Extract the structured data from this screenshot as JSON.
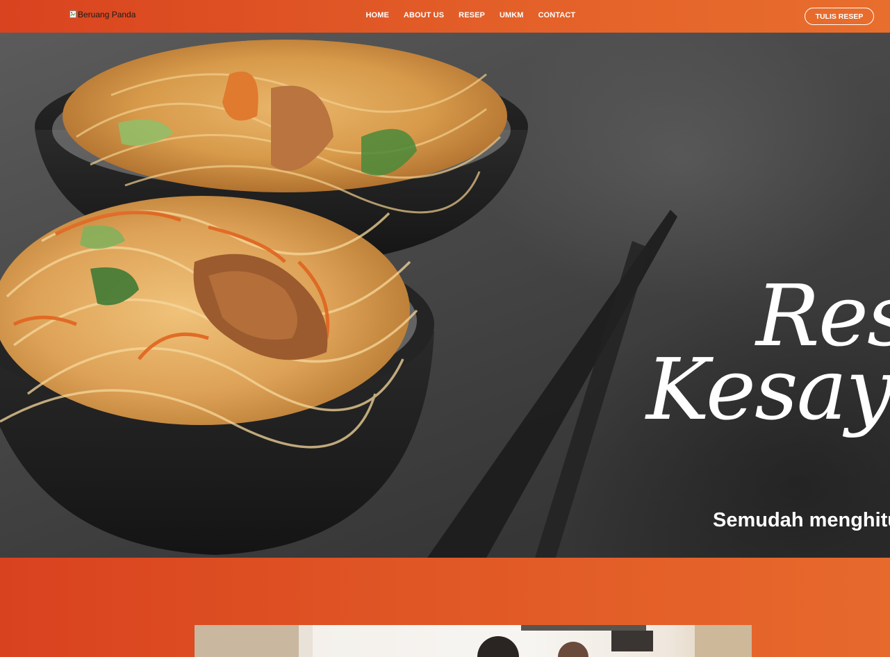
{
  "navbar": {
    "logo_alt": "Beruang Panda",
    "links": [
      {
        "label": "HOME"
      },
      {
        "label": "ABOUT US"
      },
      {
        "label": "RESEP"
      },
      {
        "label": "UMKM"
      },
      {
        "label": "CONTACT"
      }
    ],
    "cta_label": "TULIS RESEP"
  },
  "hero": {
    "title_line1": "Resep",
    "title_line2": "Kesayangan",
    "subtitle": "Semudah menghitung"
  },
  "colors": {
    "brand_orange_start": "#d9431f",
    "brand_orange_end": "#e86e2d",
    "text_white": "#ffffff"
  }
}
